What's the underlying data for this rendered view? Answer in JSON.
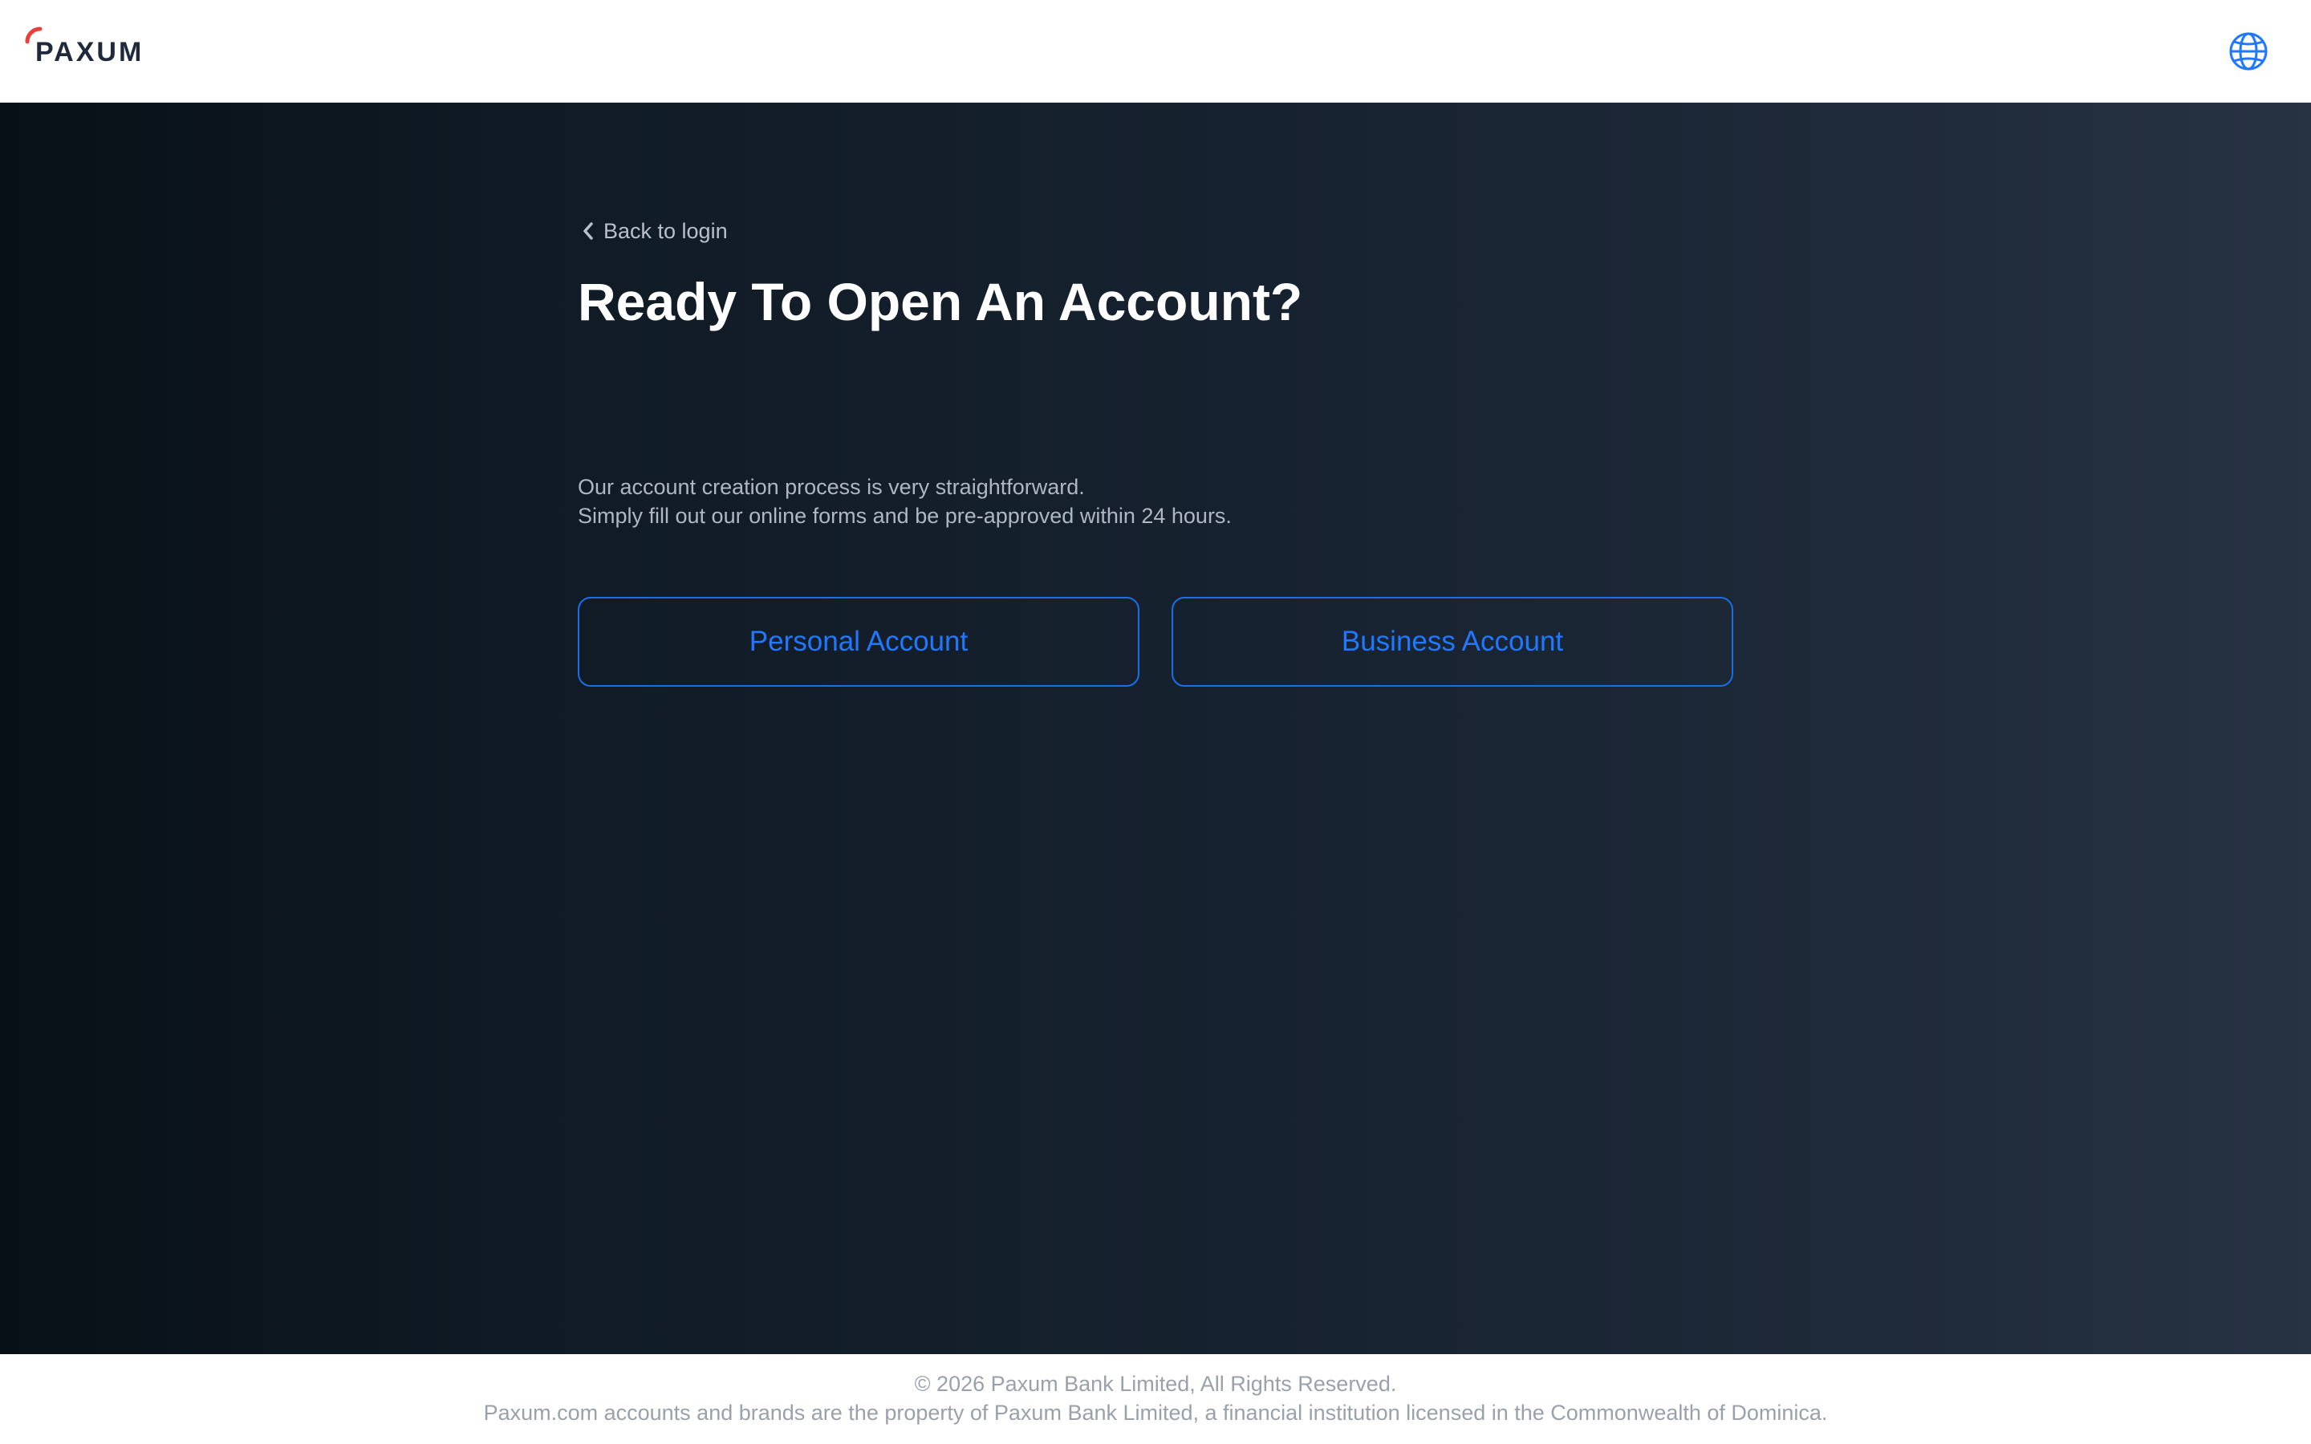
{
  "header": {
    "logo_text": "PAXUM",
    "language_icon": "globe-icon"
  },
  "main": {
    "back_link": "Back to login",
    "title": "Ready To Open An Account?",
    "description_line_1": "Our account creation process is very straightforward.",
    "description_line_2": "Simply fill out our online forms and be pre-approved within 24 hours.",
    "buttons": [
      {
        "label": "Personal Account"
      },
      {
        "label": "Business Account"
      }
    ]
  },
  "footer": {
    "copyright": "© 2026 Paxum Bank Limited, All Rights Reserved.",
    "legal": "Paxum.com accounts and brands are the property of Paxum Bank Limited, a financial institution licensed in the Commonwealth of Dominica."
  },
  "colors": {
    "accent_blue": "#1f78ff",
    "logo_red": "#e8413a",
    "logo_dark": "#1e2a3c",
    "background_dark": "#0f1a24"
  }
}
